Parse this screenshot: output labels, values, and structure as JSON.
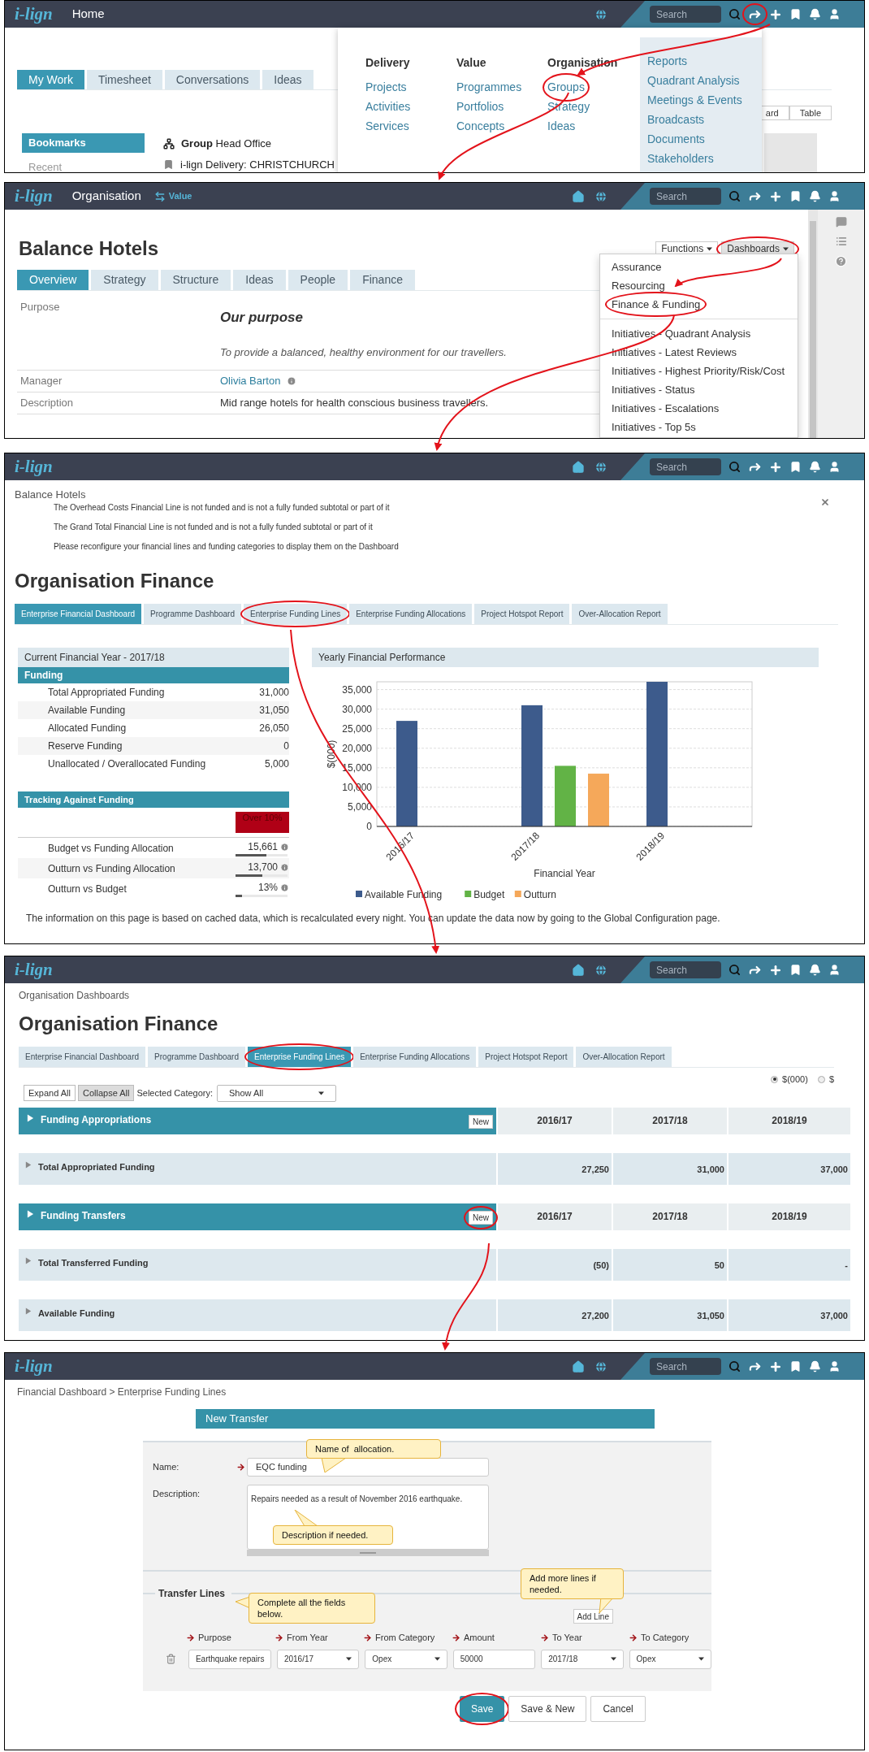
{
  "home_screen": {
    "topbar": {
      "logo": "i-lign",
      "title": "Home",
      "search_placeholder": "Search",
      "has_home": false,
      "share_highlighted": true
    },
    "tabs": [
      {
        "label": "My Work",
        "selected": true
      },
      {
        "label": "Timesheet",
        "selected": false
      },
      {
        "label": "Conversations",
        "selected": false
      },
      {
        "label": "Ideas",
        "selected": false
      }
    ],
    "view_buttons": [
      "ard",
      "Table"
    ],
    "sidebar": [
      {
        "label": "Bookmarks",
        "selected": true
      },
      {
        "label": "Recent",
        "selected": false
      }
    ],
    "bookmarks": [
      {
        "kind": "group",
        "text": "**Group** Head Office"
      },
      {
        "kind": "delivery",
        "text": "i-lign Delivery: CHRISTCHURCH"
      }
    ],
    "menu": {
      "columns": [
        {
          "heading": "Delivery",
          "items": [
            {
              "label": "Projects",
              "highlighted": false
            },
            {
              "label": "Activities",
              "highlighted": false
            },
            {
              "label": "Services",
              "highlighted": false
            }
          ]
        },
        {
          "heading": "Value",
          "items": [
            {
              "label": "Programmes",
              "highlighted": false
            },
            {
              "label": "Portfolios",
              "highlighted": false
            },
            {
              "label": "Concepts",
              "highlighted": false
            }
          ]
        },
        {
          "heading": "Organisation",
          "items": [
            {
              "label": "Groups",
              "highlighted": true
            },
            {
              "label": "Strategy",
              "highlighted": false
            },
            {
              "label": "Ideas",
              "highlighted": false
            }
          ]
        }
      ],
      "links": [
        "Reports",
        "Quadrant Analysis",
        "Meetings & Events",
        "Broadcasts",
        "Documents",
        "Stakeholders"
      ]
    }
  },
  "organisation_screen": {
    "topbar": {
      "logo": "i-lign",
      "title": "Organisation",
      "context_link": "Value",
      "search_placeholder": "Search",
      "has_home": true,
      "share_highlighted": false
    },
    "title": "Balance Hotels",
    "actions": [
      {
        "label": "Functions",
        "highlighted": false
      },
      {
        "label": "Dashboards",
        "highlighted": true
      }
    ],
    "tabs": [
      {
        "label": "Overview",
        "selected": true
      },
      {
        "label": "Strategy",
        "selected": false
      },
      {
        "label": "Structure",
        "selected": false
      },
      {
        "label": "Ideas",
        "selected": false
      },
      {
        "label": "People",
        "selected": false
      },
      {
        "label": "Finance",
        "selected": false
      }
    ],
    "fields": [
      {
        "kind": "purpose",
        "label": "Purpose",
        "heading": "Our purpose",
        "text": "To provide a balanced, healthy environment for our travellers."
      },
      {
        "kind": "person",
        "label": "Manager",
        "text": "Olivia Barton"
      },
      {
        "kind": "plain",
        "label": "Description",
        "text": "Mid range hotels for health conscious business travellers."
      }
    ],
    "dashboards_menu": [
      [
        {
          "label": "Assurance",
          "highlighted": false
        },
        {
          "label": "Resourcing",
          "highlighted": false
        },
        {
          "label": "Finance & Funding",
          "highlighted": true
        }
      ],
      [
        {
          "label": "Initiatives - Quadrant Analysis",
          "highlighted": false
        },
        {
          "label": "Initiatives - Latest Reviews",
          "highlighted": false
        },
        {
          "label": "Initiatives - Highest Priority/Risk/Cost",
          "highlighted": false
        },
        {
          "label": "Initiatives - Status",
          "highlighted": false
        },
        {
          "label": "Initiatives - Escalations",
          "highlighted": false
        },
        {
          "label": "Initiatives - Top 5s",
          "highlighted": false
        }
      ]
    ]
  },
  "finance_dashboard_screen": {
    "topbar": {
      "logo": "i-lign",
      "search_placeholder": "Search",
      "has_home": true,
      "share_highlighted": false
    },
    "breadcrumb": "Balance Hotels",
    "messages": [
      "The Overhead Costs Financial Line is not funded and is not a fully funded subtotal or part of it",
      "The Grand Total Financial Line is not funded and is not a fully funded subtotal or part of it",
      "Please reconfigure your financial lines and funding categories to display them on the Dashboard"
    ],
    "title": "Organisation Finance",
    "tabs": [
      {
        "label": "Enterprise Financial Dashboard",
        "selected": true,
        "highlighted": false
      },
      {
        "label": "Programme Dashboard",
        "selected": false,
        "highlighted": false
      },
      {
        "label": "Enterprise Funding Lines",
        "selected": false,
        "highlighted": true
      },
      {
        "label": "Enterprise Funding Allocations",
        "selected": false,
        "highlighted": false
      },
      {
        "label": "Project Hotspot Report",
        "selected": false,
        "highlighted": false
      },
      {
        "label": "Over-Allocation Report",
        "selected": false,
        "highlighted": false
      }
    ],
    "current_year": {
      "heading": "Current Financial Year - 2017/18",
      "funding": {
        "heading": "Funding",
        "rows": [
          {
            "label": "Total Appropriated Funding",
            "value": "31,000"
          },
          {
            "label": "Available Funding",
            "value": "31,050"
          },
          {
            "label": "Allocated Funding",
            "value": "26,050"
          },
          {
            "label": "Reserve Funding",
            "value": "0"
          },
          {
            "label": "Unallocated / Overallocated Funding",
            "value": "5,000"
          }
        ]
      },
      "tracking": {
        "heading": "Tracking Against Funding",
        "badge": "Over 10%",
        "rows": [
          {
            "label": "Budget vs Funding Allocation",
            "value": "15,661",
            "level": 0.6
          },
          {
            "label": "Outturn vs Funding Allocation",
            "value": "13,700",
            "level": 0.52
          },
          {
            "label": "Outturn vs Budget",
            "value": "13%",
            "level": 0.13
          }
        ]
      }
    },
    "performance": {
      "heading": "Yearly Financial Performance",
      "chart_data": {
        "type": "bar",
        "xlabel": "Financial Year",
        "ylabel": "$(000)",
        "categories": [
          "2016/17",
          "2017/18",
          "2018/19"
        ],
        "series": [
          {
            "name": "Available Funding",
            "color": "#3d5b8c",
            "values": [
              27000,
              31000,
              37000
            ]
          },
          {
            "name": "Budget",
            "color": "#62b346",
            "values": [
              null,
              15500,
              null
            ]
          },
          {
            "name": "Outturn",
            "color": "#f5a85a",
            "values": [
              null,
              13500,
              null
            ]
          }
        ],
        "grid": true,
        "legend": true,
        "ylim": [
          0,
          37000
        ],
        "yticks": [
          {
            "value": 0,
            "label": "0"
          },
          {
            "value": 5000,
            "label": "5,000"
          },
          {
            "value": 10000,
            "label": "10,000"
          },
          {
            "value": 15000,
            "label": "15,000"
          },
          {
            "value": 20000,
            "label": "20,000"
          },
          {
            "value": 25000,
            "label": "25,000"
          },
          {
            "value": 30000,
            "label": "30,000"
          },
          {
            "value": 35000,
            "label": "35,000"
          }
        ]
      }
    },
    "note": "The information on this page is based on cached data, which is recalculated every night. You can update the data now by going to the Global Configuration page."
  },
  "funding_lines_screen": {
    "topbar": {
      "logo": "i-lign",
      "search_placeholder": "Search",
      "has_home": true,
      "share_highlighted": false
    },
    "breadcrumb": "Organisation Dashboards",
    "title": "Organisation Finance",
    "tabs": [
      {
        "label": "Enterprise Financial Dashboard",
        "selected": false,
        "highlighted": false
      },
      {
        "label": "Programme Dashboard",
        "selected": false,
        "highlighted": false
      },
      {
        "label": "Enterprise Funding Lines",
        "selected": true,
        "highlighted": true
      },
      {
        "label": "Enterprise Funding Allocations",
        "selected": false,
        "highlighted": false
      },
      {
        "label": "Project Hotspot Report",
        "selected": false,
        "highlighted": false
      },
      {
        "label": "Over-Allocation Report",
        "selected": false,
        "highlighted": false
      }
    ],
    "units": [
      {
        "label": "$(000)",
        "selected": true
      },
      {
        "label": "$",
        "selected": false
      }
    ],
    "toolbar": {
      "buttons": [
        {
          "label": "Expand All",
          "selected": false
        },
        {
          "label": "Collapse All",
          "selected": true
        }
      ],
      "category_label": "Selected Category:",
      "category_value": "Show All"
    },
    "sections": [
      {
        "title": "Funding Appropriations",
        "new_label": "New",
        "new_highlighted": false,
        "years": [
          "2016/17",
          "2017/18",
          "2018/19"
        ],
        "total": {
          "label": "Total Appropriated Funding",
          "values": [
            "27,250",
            "31,000",
            "37,000"
          ]
        }
      },
      {
        "title": "Funding Transfers",
        "new_label": "New",
        "new_highlighted": true,
        "years": [
          "2016/17",
          "2017/18",
          "2018/19"
        ],
        "total": {
          "label": "Total Transferred Funding",
          "values": [
            "(50)",
            "50",
            "-"
          ]
        }
      }
    ],
    "summary": {
      "label": "Available Funding",
      "values": [
        "27,200",
        "31,050",
        "37,000"
      ]
    }
  },
  "new_transfer_screen": {
    "topbar": {
      "logo": "i-lign",
      "search_placeholder": "Search",
      "has_home": true,
      "share_highlighted": false
    },
    "breadcrumb": "Financial Dashboard > Enterprise Funding Lines",
    "form_title": "New Transfer",
    "name": {
      "label": "Name:",
      "value": "EQC funding"
    },
    "description": {
      "label": "Description:",
      "value": "Repairs needed as a result of November 2016 earthquake."
    },
    "transfer_lines": {
      "legend": "Transfer Lines",
      "add_label": "Add Line",
      "columns": [
        "Purpose",
        "From Year",
        "From Category",
        "Amount",
        "To Year",
        "To Category"
      ],
      "row": [
        {
          "kind": "input",
          "value": "Earthquake repairs"
        },
        {
          "kind": "select",
          "value": "2016/17"
        },
        {
          "kind": "select",
          "value": "Opex"
        },
        {
          "kind": "input",
          "value": "50000"
        },
        {
          "kind": "select",
          "value": "2017/18"
        },
        {
          "kind": "select",
          "value": "Opex"
        }
      ]
    },
    "callouts": [
      {
        "kind": "name",
        "text": "Name of  allocation."
      },
      {
        "kind": "description",
        "text": "Description if needed."
      },
      {
        "kind": "add",
        "text": "Add more lines if needed."
      },
      {
        "kind": "lines",
        "text": "Complete all the fields below."
      }
    ],
    "buttons": [
      {
        "label": "Save",
        "kind": "primary",
        "highlighted": true
      },
      {
        "label": "Save & New",
        "kind": "secondary",
        "highlighted": false
      },
      {
        "label": "Cancel",
        "kind": "secondary",
        "highlighted": false
      }
    ]
  }
}
